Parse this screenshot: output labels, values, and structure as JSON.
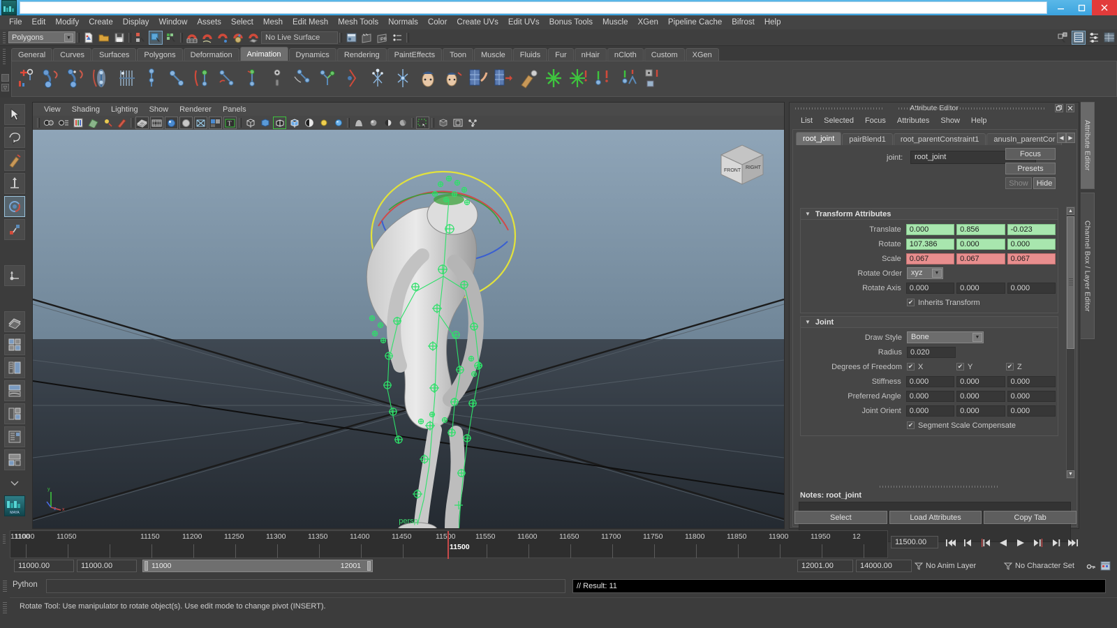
{
  "window": {
    "title": "",
    "minimize_label": "–",
    "maximize_label": "❐",
    "close_label": "✕",
    "app_icon_text": "MAYA"
  },
  "menubar": {
    "items": [
      "File",
      "Edit",
      "Modify",
      "Create",
      "Display",
      "Window",
      "Assets",
      "Select",
      "Mesh",
      "Edit Mesh",
      "Mesh Tools",
      "Normals",
      "Color",
      "Create UVs",
      "Edit UVs",
      "Bonus Tools",
      "Muscle",
      "XGen",
      "Pipeline Cache",
      "Bifrost",
      "Help"
    ]
  },
  "statusline": {
    "menuset": "Polygons",
    "live_surface": "No Live Surface"
  },
  "shelf": {
    "tabs": [
      "General",
      "Curves",
      "Surfaces",
      "Polygons",
      "Deformation",
      "Animation",
      "Dynamics",
      "Rendering",
      "PaintEffects",
      "Toon",
      "Muscle",
      "Fluids",
      "Fur",
      "nHair",
      "nCloth",
      "Custom",
      "XGen"
    ],
    "active_tab": "Animation"
  },
  "viewport": {
    "menus": [
      "View",
      "Shading",
      "Lighting",
      "Show",
      "Renderer",
      "Panels"
    ],
    "camera_label": "persp",
    "viewcube": {
      "front": "FRONT",
      "right": "RIGHT"
    },
    "axis": {
      "x": "x",
      "y": "y",
      "z": "z"
    }
  },
  "attribute_editor": {
    "title": "Attribute Editor",
    "menus": [
      "List",
      "Selected",
      "Focus",
      "Attributes",
      "Show",
      "Help"
    ],
    "tabs": [
      "root_joint",
      "pairBlend1",
      "root_parentConstraint1",
      "anusIn_parentCor"
    ],
    "active_tab": "root_joint",
    "node_label": "joint:",
    "node_name": "root_joint",
    "buttons": {
      "focus": "Focus",
      "presets": "Presets",
      "show": "Show",
      "hide": "Hide"
    },
    "transform_section": {
      "title": "Transform Attributes",
      "rows": [
        {
          "label": "Translate",
          "values": [
            "0.000",
            "0.856",
            "-0.023"
          ],
          "state": "green"
        },
        {
          "label": "Rotate",
          "values": [
            "107.386",
            "0.000",
            "0.000"
          ],
          "state": "green"
        },
        {
          "label": "Scale",
          "values": [
            "0.067",
            "0.067",
            "0.067"
          ],
          "state": "red"
        }
      ],
      "rotate_order": {
        "label": "Rotate Order",
        "value": "xyz"
      },
      "rotate_axis": {
        "label": "Rotate Axis",
        "values": [
          "0.000",
          "0.000",
          "0.000"
        ]
      },
      "inherits_transform": {
        "label": "Inherits Transform",
        "checked": true
      }
    },
    "joint_section": {
      "title": "Joint",
      "draw_style": {
        "label": "Draw Style",
        "value": "Bone"
      },
      "radius": {
        "label": "Radius",
        "value": "0.020"
      },
      "dof": {
        "label": "Degrees of Freedom",
        "axes": [
          "X",
          "Y",
          "Z"
        ],
        "checked": [
          true,
          true,
          true
        ]
      },
      "stiffness": {
        "label": "Stiffness",
        "values": [
          "0.000",
          "0.000",
          "0.000"
        ]
      },
      "preferred_angle": {
        "label": "Preferred Angle",
        "values": [
          "0.000",
          "0.000",
          "0.000"
        ]
      },
      "joint_orient": {
        "label": "Joint Orient",
        "values": [
          "0.000",
          "0.000",
          "0.000"
        ]
      },
      "segment_scale_compensate": {
        "label": "Segment Scale Compensate",
        "checked": true
      }
    },
    "notes": {
      "label": "Notes: root_joint",
      "value": ""
    },
    "footer_buttons": [
      "Select",
      "Load Attributes",
      "Copy Tab"
    ]
  },
  "right_dock_tabs": [
    "Attribute Editor",
    "Channel Box / Layer Editor"
  ],
  "timeslider": {
    "tick_labels": [
      "11000",
      "11050",
      "11100",
      "11150",
      "11200",
      "11250",
      "11300",
      "11350",
      "11400",
      "11450",
      "11500",
      "11550",
      "11600",
      "11650",
      "11700",
      "11750",
      "11800",
      "11850",
      "11900",
      "11950",
      "12"
    ],
    "current_frame": "11500",
    "current_frame_field": "11500.00",
    "playback_buttons": [
      "go-to-start",
      "step-back-key",
      "step-back-frame",
      "play-backwards",
      "play-forwards",
      "step-forward-frame",
      "step-forward-key",
      "go-to-end"
    ]
  },
  "rangeslider": {
    "anim_start": "11000.00",
    "range_start": "11000.00",
    "bar_start_label": "11000",
    "bar_end_label": "12001",
    "range_end": "12001.00",
    "anim_end": "14000.00",
    "anim_layer": "No Anim Layer",
    "character_set": "No Character Set"
  },
  "commandline": {
    "language": "Python",
    "input_value": "",
    "result": "// Result: 11"
  },
  "helpline": {
    "text": "Rotate Tool: Use manipulator to rotate object(s). Use edit mode to change pivot (INSERT)."
  },
  "colors": {
    "accent_titlebar": "#3ba3de",
    "field_green": "#a8e6ae",
    "field_red": "#e88e8e",
    "playhead_red": "#c84a4a",
    "viewport_label_green": "#3ddc6e",
    "panel_bg": "#444444"
  }
}
